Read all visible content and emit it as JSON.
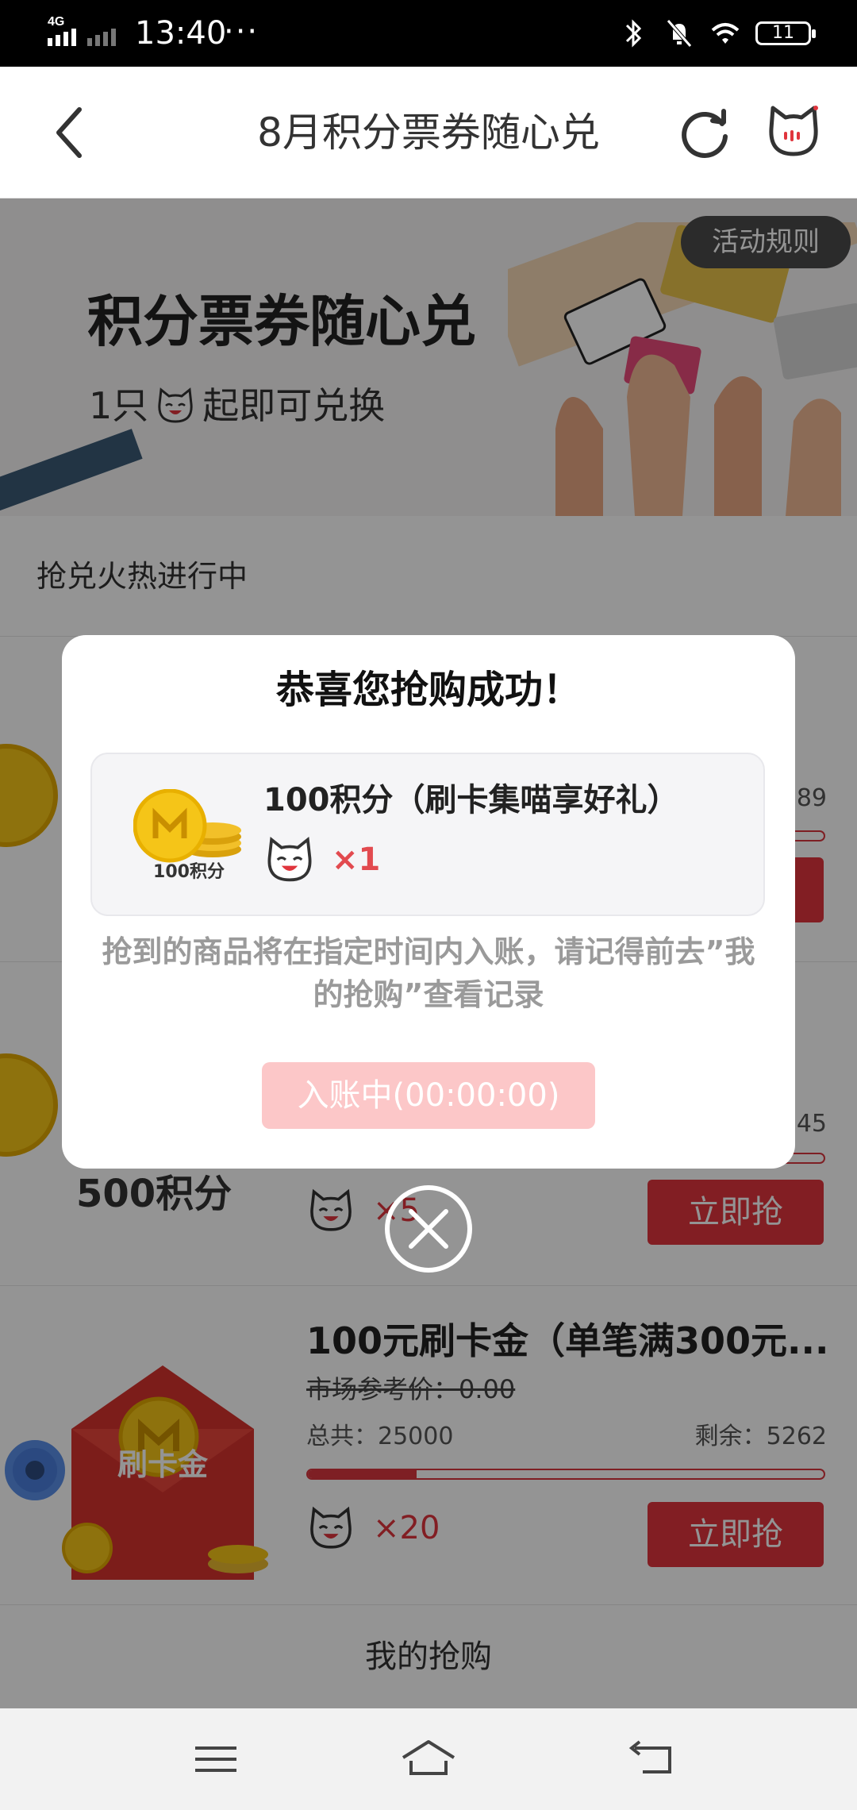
{
  "status_bar": {
    "network": "4G",
    "time": "13:40",
    "dots": "···",
    "battery": "11"
  },
  "header": {
    "title": "8月积分票券随心兑",
    "icons": [
      "back-icon",
      "refresh-icon",
      "cat-mascot-icon"
    ]
  },
  "banner": {
    "title": "积分票券随心兑",
    "subtitle_before": "1只",
    "subtitle_after": "起即可兑换",
    "rules_button": "活动规则"
  },
  "section": {
    "label": "抢兑火热进行中"
  },
  "items": [
    {
      "remain_partial": "89"
    },
    {
      "name": "500积分",
      "remain_partial": "45",
      "multiplier": "×5",
      "grab_label": "立即抢"
    },
    {
      "title": "100元刷卡金（单笔满300元...",
      "market_price": "市场参考价：0.00",
      "total": "总共：25000",
      "remain": "剩余：5262",
      "progress": 0.21,
      "multiplier": "×20",
      "grab_label": "立即抢",
      "envelope_label": "刷卡金"
    }
  ],
  "footer": {
    "my_grab": "我的抢购"
  },
  "modal": {
    "title": "恭喜您抢购成功！",
    "prize_name": "100积分（刷卡集喵享好礼）",
    "coin_label": "100积分",
    "quantity": "×1",
    "note": "抢到的商品将在指定时间内入账，请记得前去”我的抢购”查看记录",
    "status_button": "入账中(00:00:00)"
  },
  "colors": {
    "accent": "#e0353d",
    "status_button_bg": "#fcc7c8",
    "overlay": "rgba(0,0,0,0.42)"
  }
}
